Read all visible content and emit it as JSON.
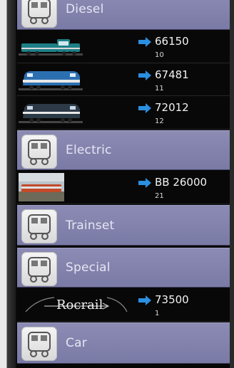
{
  "categories": {
    "diesel": {
      "label": "Diesel"
    },
    "electric": {
      "label": "Electric"
    },
    "trainset": {
      "label": "Trainset"
    },
    "special": {
      "label": "Special"
    },
    "car": {
      "label": "Car"
    }
  },
  "locos": [
    {
      "id": "66150",
      "sub": "10",
      "image": "diesel-locomotive-image"
    },
    {
      "id": "67481",
      "sub": "11",
      "image": "diesel-locomotive-image"
    },
    {
      "id": "72012",
      "sub": "12",
      "image": "diesel-locomotive-image"
    },
    {
      "id": "BB 26000",
      "sub": "21",
      "image": "electric-train-photo"
    },
    {
      "id": "73500",
      "sub": "1",
      "image": "rocrail-logo"
    }
  ],
  "logo_text": "Rocrail",
  "colors": {
    "category_bg": "#8080aa",
    "category_text": "#e6e6f4",
    "list_bg": "#080808",
    "arrow": "#2b8fe0"
  },
  "icons": {
    "category": "locomotive-icon",
    "direction": "arrow-right-icon"
  }
}
